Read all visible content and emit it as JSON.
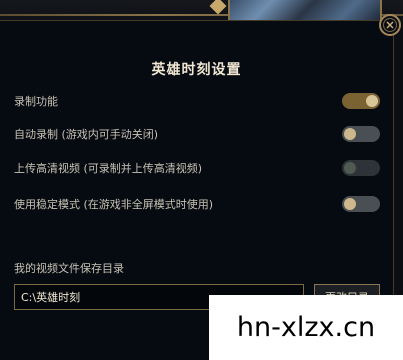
{
  "dialog": {
    "title": "英雄时刻设置",
    "close_icon": "close-icon"
  },
  "settings": [
    {
      "label": "录制功能",
      "state": "on"
    },
    {
      "label": "自动录制 (游戏内可手动关闭)",
      "state": "off"
    },
    {
      "label": "上传高清视频 (可录制并上传高清视频)",
      "state": "disabled"
    },
    {
      "label": "使用稳定模式 (在游戏非全屏模式时使用)",
      "state": "off"
    }
  ],
  "folder": {
    "label": "我的视频文件保存目录",
    "path": "C:\\英雄时刻",
    "change_button": "更改目录"
  },
  "watermark": {
    "text": "hn-xlzx.cn"
  },
  "colors": {
    "accent_gold": "#a6895a",
    "toggle_on": "#7a6232",
    "title": "#f0e6d2"
  }
}
